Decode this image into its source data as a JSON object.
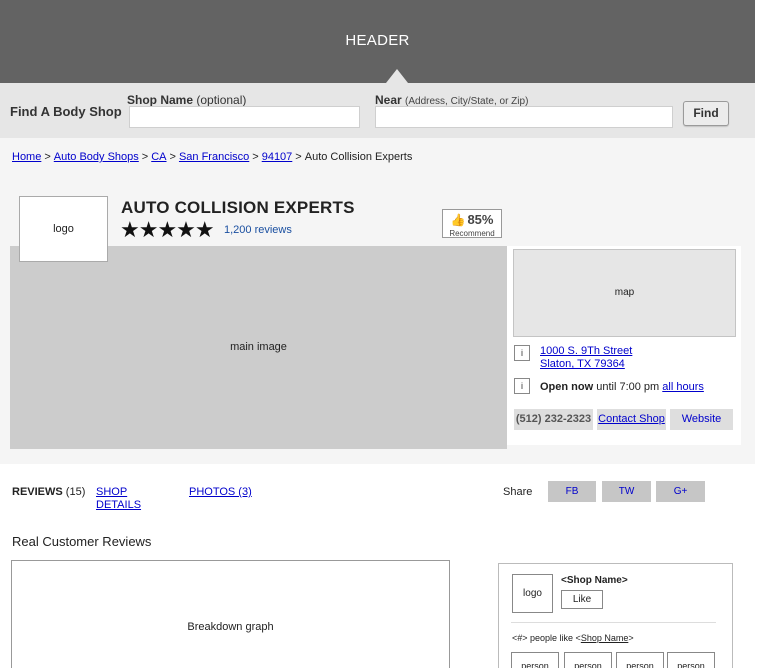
{
  "header": {
    "title": "HEADER"
  },
  "search": {
    "find_label": "Find A Body Shop",
    "shop_label": "Shop Name",
    "shop_hint": "(optional)",
    "shop_value": "",
    "near_label": "Near",
    "near_hint": "(Address, City/State, or Zip)",
    "near_value": "",
    "find_button": "Find"
  },
  "breadcrumb": {
    "items": [
      "Home",
      "Auto Body Shops",
      "CA",
      "San Francisco",
      "94107"
    ],
    "current": "Auto Collision Experts",
    "separator": ">"
  },
  "shop": {
    "logo": "logo",
    "name": "AUTO COLLISION EXPERTS",
    "stars": "★★★★★",
    "rating": 5,
    "reviews_link": "1,200 reviews",
    "recommend_pct": "85%",
    "recommend_label": "Recommend",
    "main_image": "main image",
    "map": "map",
    "info_icon": "i",
    "address_line1": "1000 S. 9Th Street",
    "address_line2": "Slaton, TX 79364",
    "open_status": "Open now",
    "open_until": "until 7:00 pm",
    "all_hours": "all hours",
    "phone": "(512) 232-2323",
    "contact": "Contact Shop",
    "website": "Website"
  },
  "tabs": {
    "reviews_label": "REVIEWS",
    "reviews_count": "(15)",
    "shop_details": "SHOP DETAILS",
    "photos": "PHOTOS (3)"
  },
  "share": {
    "label": "Share",
    "fb": "FB",
    "tw": "TW",
    "gplus": "G+"
  },
  "reviews_section": {
    "title": "Real Customer Reviews",
    "graph": "Breakdown graph"
  },
  "like_box": {
    "logo": "logo",
    "shop_name": "<Shop Name>",
    "like_button": "Like",
    "people_prefix": "<#> people like <",
    "people_link": "Shop Name",
    "people_suffix": ">",
    "persons": [
      "person",
      "person",
      "person",
      "person"
    ]
  },
  "colors": {
    "header_bg": "#636363",
    "searchbar_bg": "#e6e6e6",
    "link": "#0000cc",
    "image_placeholder": "#cccccc"
  }
}
